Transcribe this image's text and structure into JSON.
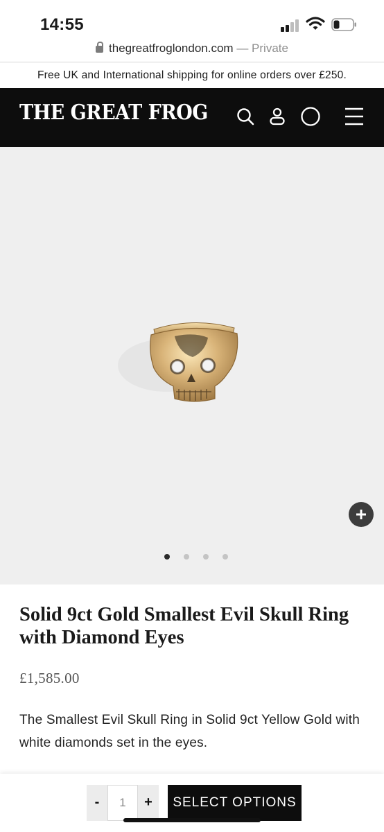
{
  "status_bar": {
    "time": "14:55",
    "icons": [
      "signal-icon",
      "wifi-icon",
      "battery-icon"
    ]
  },
  "browser": {
    "url": "thegreatfroglondon.com",
    "separator": " — ",
    "private_label": "Private"
  },
  "banner": {
    "text": "Free UK and International shipping for online orders over £250."
  },
  "header": {
    "logo": "THE GREAT FROG",
    "icons": [
      "search-icon",
      "account-icon",
      "cart-icon",
      "menu-icon"
    ]
  },
  "gallery": {
    "image_description_icon": "skull-ring-image",
    "slide_count": 4,
    "active_slide": 1,
    "zoom_icon": "plus-icon"
  },
  "product": {
    "title": "Solid 9ct Gold Smallest Evil Skull Ring with Diamond Eyes",
    "price": "£1,585.00",
    "description": "The Smallest Evil Skull Ring in Solid 9ct Yellow Gold with white diamonds set in the eyes."
  },
  "cart_bar": {
    "decrement_label": "-",
    "quantity": "1",
    "increment_label": "+",
    "select_label": "SELECT OPTIONS"
  },
  "colors": {
    "header_bg": "#0d0d0d",
    "gallery_bg": "#efefef",
    "button_bg": "#0d0d0d"
  }
}
